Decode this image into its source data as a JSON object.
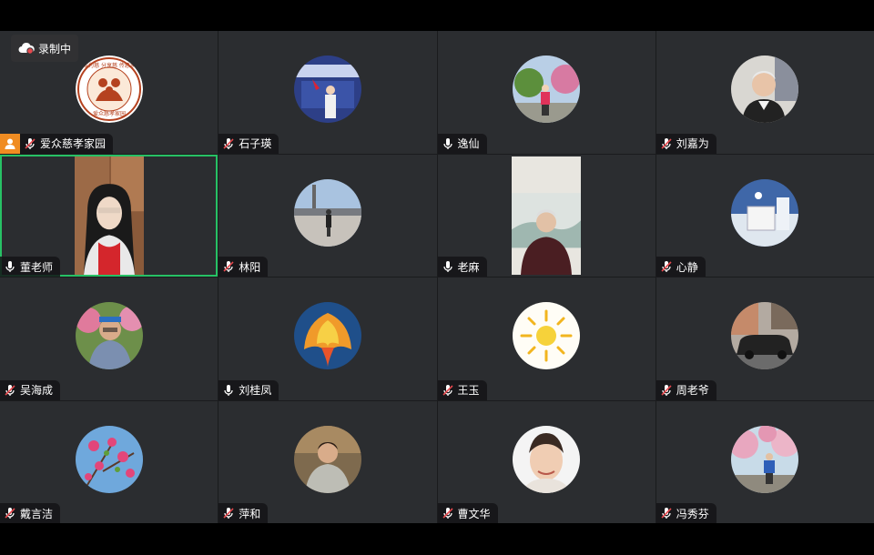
{
  "recording": {
    "label": "录制中"
  },
  "participants": [
    {
      "name": "爱众慈孝家园",
      "mic": "muted",
      "host": true,
      "logo_text": [
        "成为慈",
        "分享慈",
        "传慈孝"
      ],
      "logo_footer": "爱众慈孝家园"
    },
    {
      "name": "石子瑛",
      "mic": "muted"
    },
    {
      "name": "逸仙",
      "mic": "on"
    },
    {
      "name": "刘嘉为",
      "mic": "muted"
    },
    {
      "name": "董老师",
      "mic": "on",
      "active_speaker": true
    },
    {
      "name": "林阳",
      "mic": "muted"
    },
    {
      "name": "老麻",
      "mic": "on"
    },
    {
      "name": "心静",
      "mic": "muted"
    },
    {
      "name": "吴海成",
      "mic": "muted"
    },
    {
      "name": "刘桂凤",
      "mic": "on"
    },
    {
      "name": "王玉",
      "mic": "muted"
    },
    {
      "name": "周老爷",
      "mic": "muted"
    },
    {
      "name": "戴言洁",
      "mic": "muted"
    },
    {
      "name": "萍和",
      "mic": "muted"
    },
    {
      "name": "曹文华",
      "mic": "muted"
    },
    {
      "name": "冯秀芬",
      "mic": "muted"
    }
  ],
  "colors": {
    "active_border": "#27c165",
    "host_badge": "#f08c22",
    "muted_slash": "#e5484d",
    "tile_bg": "#2b2d30"
  }
}
